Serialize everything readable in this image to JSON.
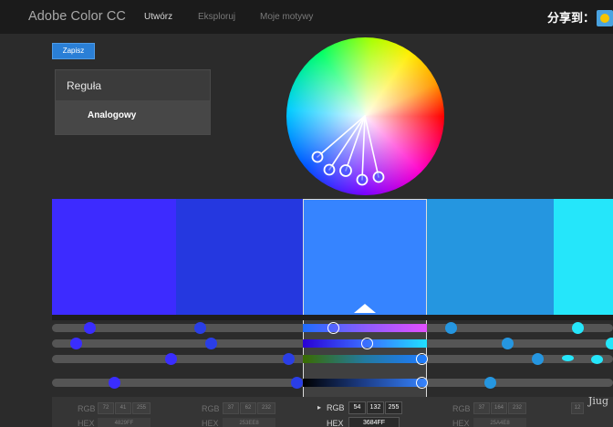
{
  "app": {
    "title": "Adobe Color CC",
    "tabs": [
      {
        "label": "Utwórz",
        "active": true
      },
      {
        "label": "Eksploruj",
        "active": false
      },
      {
        "label": "Moje motywy",
        "active": false
      }
    ],
    "share_label": "分享到：",
    "share_icon": "share-star-icon"
  },
  "toolbar": {
    "save_label": "Zapisz"
  },
  "rule": {
    "header": "Reguła",
    "value": "Analogowy"
  },
  "swatches": [
    {
      "hex": "#3d2bff",
      "selected": false
    },
    {
      "hex": "#2538e0",
      "selected": false
    },
    {
      "hex": "#3684ff",
      "selected": true
    },
    {
      "hex": "#2596e0",
      "selected": false
    },
    {
      "hex": "#25e6fa",
      "selected": false
    }
  ],
  "values": [
    {
      "rgb_label": "RGB",
      "rgb": [
        "72",
        "41",
        "255"
      ],
      "hex_label": "HEX",
      "hex": "4829FF"
    },
    {
      "rgb_label": "RGB",
      "rgb": [
        "37",
        "62",
        "232"
      ],
      "hex_label": "HEX",
      "hex": "253EE8"
    },
    {
      "rgb_label": "RGB",
      "rgb": [
        "54",
        "132",
        "255"
      ],
      "hex_label": "HEX",
      "hex": "3684FF"
    },
    {
      "rgb_label": "RGB",
      "rgb": [
        "37",
        "164",
        "232"
      ],
      "hex_label": "HEX",
      "hex": "25A4E8"
    },
    {
      "rgb_label": "",
      "rgb": [
        "12"
      ],
      "hex_label": "",
      "hex": ""
    }
  ],
  "watermark": "Jiug",
  "colors": {
    "accent": "#2a7fd6",
    "topbar": "#1b1b1b",
    "background": "#2b2b2b"
  }
}
